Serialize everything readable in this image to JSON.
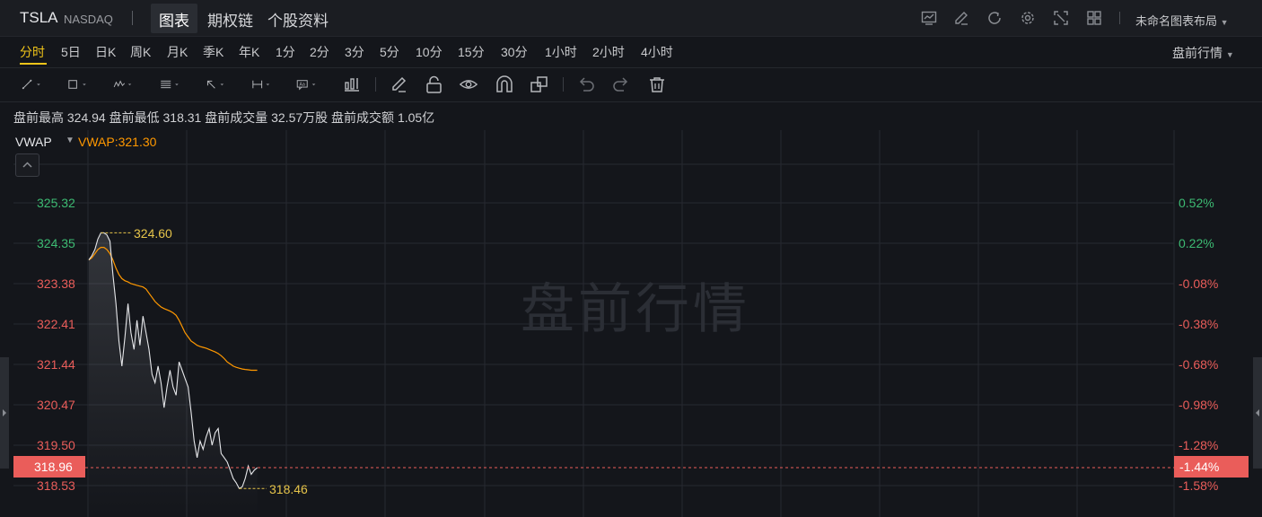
{
  "header": {
    "symbol": "TSLA",
    "exchange": "NASDAQ",
    "tabs": [
      {
        "label": "图表",
        "active": true
      },
      {
        "label": "期权链",
        "active": false
      },
      {
        "label": "个股资料",
        "active": false
      }
    ],
    "icons": [
      "chart-icon",
      "edit-icon",
      "refresh-icon",
      "settings-icon",
      "fullscreen-icon",
      "grid-icon"
    ],
    "layout_label": "未命名图表布局"
  },
  "periods": [
    "分时",
    "5日",
    "日K",
    "周K",
    "月K",
    "季K",
    "年K",
    "1分",
    "2分",
    "3分",
    "5分",
    "10分",
    "15分",
    "30分",
    "1小时",
    "2小时",
    "4小时"
  ],
  "active_period": "分时",
  "session_dropdown": "盘前行情",
  "drawing_tools": [
    "line-tool-icon",
    "rectangle-tool-icon",
    "wave-tool-icon",
    "fibonacci-tool-icon",
    "arrow-tool-icon",
    "measure-tool-icon",
    "text-tool-icon",
    "indicator-tool-icon",
    "pencil-icon",
    "unlock-icon",
    "eye-icon",
    "magnet-icon",
    "clone-icon",
    "undo-icon",
    "redo-icon",
    "trash-icon"
  ],
  "stats": {
    "high_label": "盘前最高",
    "high": "324.94",
    "low_label": "盘前最低",
    "low": "318.31",
    "volume_label": "盘前成交量",
    "volume": "32.57万股",
    "amount_label": "盘前成交额",
    "amount": "1.05亿"
  },
  "indicator": {
    "name": "VWAP",
    "value_text": "VWAP:321.30"
  },
  "watermark": "盘前行情",
  "colors": {
    "up": "#3dbb73",
    "down": "#ea5d5a",
    "vwap": "#ff9800",
    "price_line": "#e6e7ea",
    "highlight": "#f0c419"
  },
  "chart_data": {
    "type": "line",
    "price_axis": [
      "325.32",
      "324.35",
      "323.38",
      "322.41",
      "321.44",
      "320.47",
      "319.50",
      "318.53"
    ],
    "pct_axis": [
      "0.52%",
      "0.22%",
      "-0.08%",
      "-0.38%",
      "-0.68%",
      "-0.98%",
      "-1.28%",
      "-1.58%"
    ],
    "current_price": "318.96",
    "current_pct": "-1.44%",
    "max_label": "324.60",
    "min_label": "318.46",
    "series": [
      {
        "values": [
          323.95,
          324.05,
          324.2,
          324.45,
          324.6,
          324.6,
          324.55,
          324.4,
          323.6,
          322.9,
          322.0,
          321.4,
          322.1,
          322.9,
          322.2,
          321.8,
          322.5,
          321.9,
          322.6,
          322.2,
          321.8,
          321.2,
          321.0,
          321.4,
          321.0,
          320.4,
          320.9,
          321.3,
          320.9,
          320.7,
          321.5,
          321.3,
          321.1,
          320.9,
          320.3,
          319.6,
          319.2,
          319.6,
          319.4,
          319.7,
          319.9,
          319.5,
          319.8,
          319.9,
          319.3,
          319.2,
          319.1,
          318.9,
          318.7,
          318.6,
          318.46,
          318.5,
          318.7,
          319.0,
          318.8,
          318.9,
          318.96
        ]
      },
      {
        "name": "VWAP",
        "values": [
          323.95,
          324.0,
          324.1,
          324.2,
          324.25,
          324.25,
          324.2,
          324.1,
          323.95,
          323.75,
          323.6,
          323.5,
          323.45,
          323.42,
          323.38,
          323.36,
          323.34,
          323.32,
          323.3,
          323.25,
          323.15,
          323.05,
          322.95,
          322.88,
          322.82,
          322.78,
          322.75,
          322.72,
          322.68,
          322.62,
          322.5,
          322.35,
          322.2,
          322.1,
          322.0,
          321.95,
          321.9,
          321.87,
          321.85,
          321.83,
          321.8,
          321.77,
          321.74,
          321.7,
          321.65,
          321.58,
          321.5,
          321.45,
          321.4,
          321.37,
          321.35,
          321.33,
          321.32,
          321.31,
          321.3,
          321.3,
          321.3
        ]
      }
    ]
  }
}
